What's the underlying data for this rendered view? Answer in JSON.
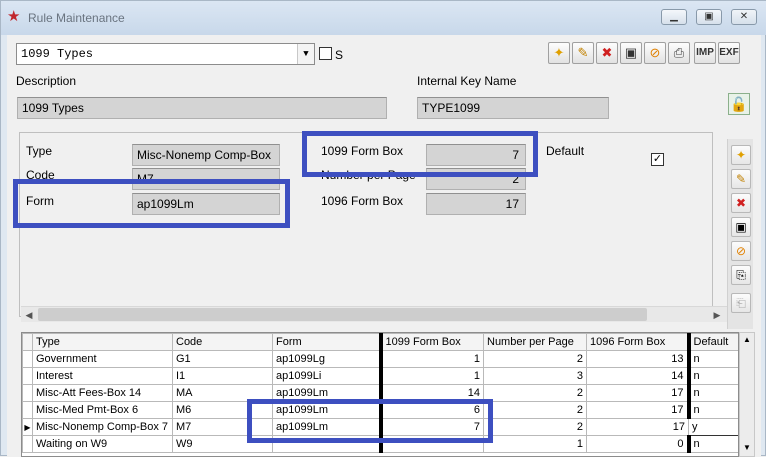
{
  "window": {
    "title": "Rule Maintenance",
    "minimize": "▭",
    "restore": "▣",
    "close": "✕"
  },
  "toolbar": {
    "selected_rule": "1099 Types",
    "s_checkbox_label": "S",
    "buttons": [
      {
        "name": "new-icon",
        "glyph": "✦"
      },
      {
        "name": "edit-icon",
        "glyph": "✎"
      },
      {
        "name": "delete-icon",
        "glyph": "✖"
      },
      {
        "name": "save-icon",
        "glyph": "▣"
      },
      {
        "name": "cancel-icon",
        "glyph": "⊘"
      },
      {
        "name": "print-icon",
        "glyph": "⎙"
      },
      {
        "name": "import-button",
        "glyph": "IMP"
      },
      {
        "name": "export-button",
        "glyph": "EXF"
      }
    ]
  },
  "header": {
    "description_label": "Description",
    "description_value": "1099 Types",
    "internal_key_label": "Internal Key Name",
    "internal_key_value": "TYPE1099"
  },
  "detail": {
    "type_label": "Type",
    "type_value": "Misc-Nonemp Comp-Box",
    "code_label": "Code",
    "code_value": "M7",
    "form_label": "Form",
    "form_value": "ap1099Lm",
    "form_box_label": "1099 Form Box",
    "form_box_value": "7",
    "number_per_page_label": "Number per Page",
    "number_per_page_value": "2",
    "box_1096_label": "1096 Form Box",
    "box_1096_value": "17",
    "default_label": "Default",
    "default_checked": "✓"
  },
  "grid": {
    "columns": [
      "Type",
      "Code",
      "Form",
      "1099 Form Box",
      "Number per Page",
      "1096 Form Box",
      "Default"
    ],
    "rows": [
      [
        "Government",
        "G1",
        "ap1099Lg",
        "1",
        "2",
        "13",
        "n"
      ],
      [
        "Interest",
        "I1",
        "ap1099Li",
        "1",
        "3",
        "14",
        "n"
      ],
      [
        "Misc-Att Fees-Box 14",
        "MA",
        "ap1099Lm",
        "14",
        "2",
        "17",
        "n"
      ],
      [
        "Misc-Med Pmt-Box 6",
        "M6",
        "ap1099Lm",
        "6",
        "2",
        "17",
        "n"
      ],
      [
        "Misc-Nonemp Comp-Box 7",
        "M7",
        "ap1099Lm",
        "7",
        "2",
        "17",
        "y"
      ],
      [
        "Waiting on W9",
        "W9",
        "",
        "",
        "1",
        "0",
        "n"
      ]
    ],
    "current_row_marker": "▶"
  },
  "colors": {
    "highlight": "#3d4fc0",
    "title_text": "#6a7480"
  }
}
